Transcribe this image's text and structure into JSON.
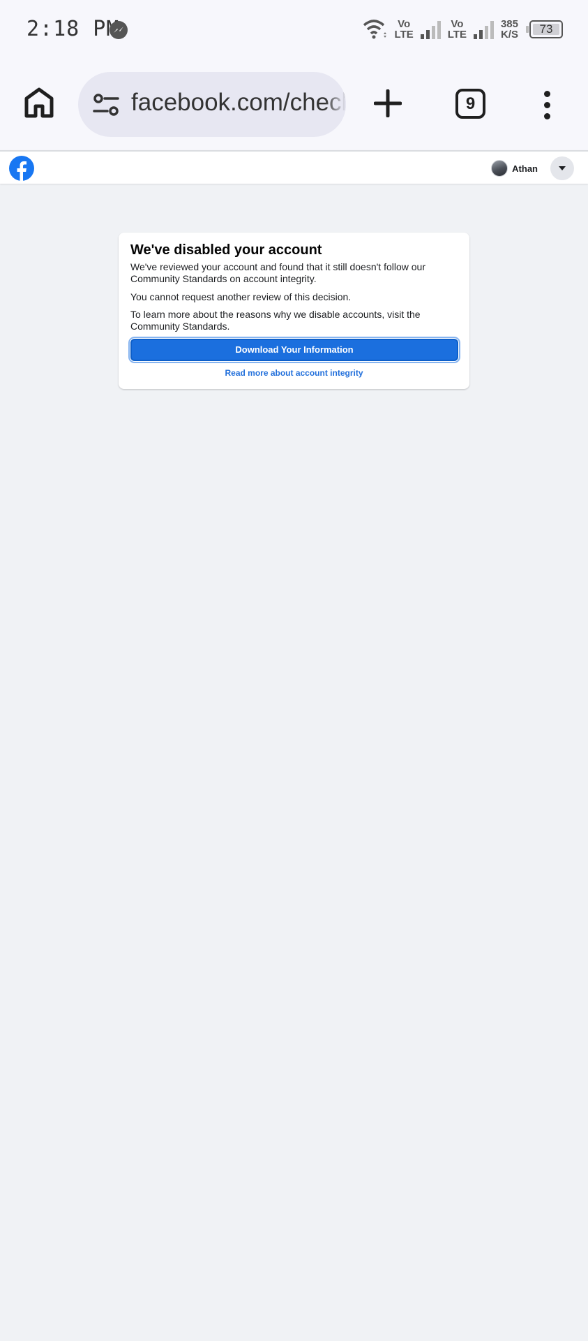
{
  "status_bar": {
    "time": "2:18 PM",
    "network_label_top": "Vo",
    "network_label_bottom": "LTE",
    "speed_value": "385",
    "speed_unit": "K/S",
    "battery": "73"
  },
  "browser": {
    "url": "facebook.com/checl",
    "tab_count": "9"
  },
  "header": {
    "user_name": "Athan"
  },
  "card": {
    "title": "We've disabled your account",
    "paragraph1": "We've reviewed your account and found that it still doesn't follow our Community Standards on account integrity.",
    "paragraph2": "You cannot request another review of this decision.",
    "paragraph3": "To learn more about the reasons why we disable accounts, visit the Community Standards.",
    "download_button": "Download Your Information",
    "read_more_link": "Read more about account integrity"
  },
  "colors": {
    "facebook_blue": "#1877f2",
    "button_blue": "#1b6fde",
    "link_blue": "#216fdb",
    "page_background": "#f0f2f5"
  },
  "icons": {
    "home": "home-icon",
    "tune": "site-settings-icon",
    "plus": "new-tab-icon",
    "menu": "more-vert-icon",
    "facebook": "facebook-logo",
    "caret": "caret-down-icon",
    "messenger": "messenger-icon",
    "wifi": "wifi-icon"
  }
}
